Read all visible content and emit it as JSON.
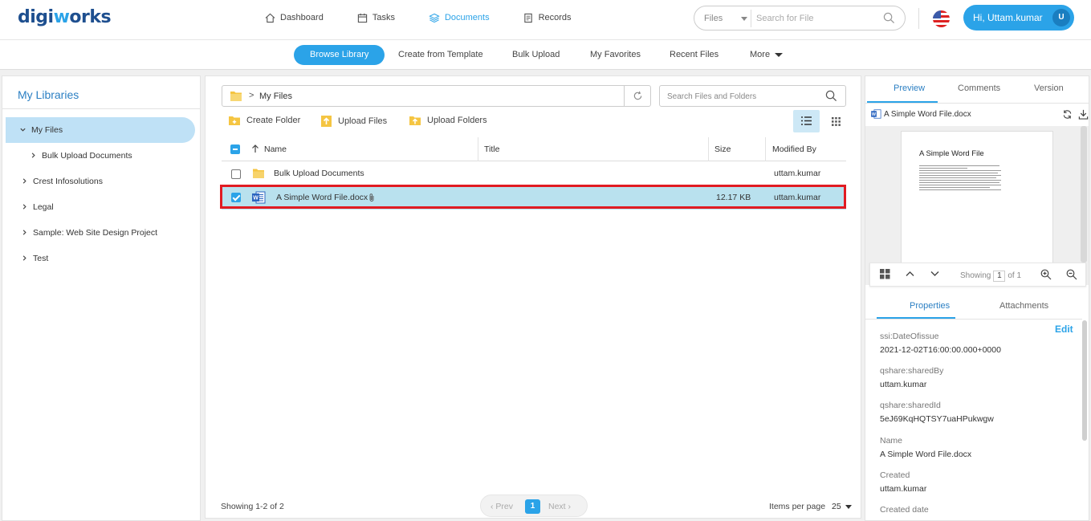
{
  "header": {
    "logo_pre": "digi",
    "logo_o": "w",
    "logo_post": "orks",
    "nav": [
      {
        "label": "Dashboard",
        "icon": "home-icon"
      },
      {
        "label": "Tasks",
        "icon": "calendar-icon"
      },
      {
        "label": "Documents",
        "icon": "layers-icon",
        "active": true
      },
      {
        "label": "Records",
        "icon": "records-icon"
      }
    ],
    "search": {
      "scope": "Files",
      "placeholder": "Search for File"
    },
    "user": {
      "greeting": "Hi,  Uttam.kumar",
      "initial": "U"
    }
  },
  "subnav": {
    "tabs": [
      "Browse Library",
      "Create from Template",
      "Bulk Upload",
      "My Favorites",
      "Recent Files",
      "More"
    ]
  },
  "libraries": {
    "title": "My Libraries",
    "items": [
      {
        "label": "My Files",
        "expanded": true
      },
      {
        "label": "Bulk Upload Documents"
      },
      {
        "label": "Crest Infosolutions"
      },
      {
        "label": "Legal"
      },
      {
        "label": "Sample: Web Site Design Project"
      },
      {
        "label": "Test"
      }
    ]
  },
  "browser": {
    "breadcrumb": "My Files",
    "search_placeholder": "Search Files and Folders",
    "actions": [
      "Create Folder",
      "Upload Files",
      "Upload Folders"
    ],
    "columns": [
      "Name",
      "Title",
      "Size",
      "Modified By"
    ],
    "rows": [
      {
        "name": "Bulk Upload Documents",
        "title": "",
        "size": "",
        "modified_by": "uttam.kumar",
        "type": "folder",
        "selected": false
      },
      {
        "name": "A Simple Word File.docx",
        "title": "",
        "size": "12.17 KB",
        "modified_by": "uttam.kumar",
        "type": "word",
        "selected": true
      }
    ],
    "showing": "Showing 1-2 of 2",
    "pager": {
      "prev": "Prev",
      "page": "1",
      "next": "Next"
    },
    "items_per_page_label": "Items per page",
    "items_per_page": "25"
  },
  "details": {
    "tabs": [
      "Preview",
      "Comments",
      "Version"
    ],
    "file_name": "A Simple Word File.docx",
    "preview": {
      "heading": "A Simple Word File",
      "showing_label": "Showing",
      "page": "1",
      "of_label": "of 1"
    },
    "prop_tabs": [
      "Properties",
      "Attachments"
    ],
    "edit_label": "Edit",
    "properties": [
      {
        "key": "ssi:DateOfissue",
        "value": "2021-12-02T16:00:00.000+0000"
      },
      {
        "key": "qshare:sharedBy",
        "value": "uttam.kumar"
      },
      {
        "key": "qshare:sharedId",
        "value": "5eJ69KqHQTSY7uaHPukwgw"
      },
      {
        "key": "Name",
        "value": "A Simple Word File.docx"
      },
      {
        "key": "Created",
        "value": "uttam.kumar"
      },
      {
        "key": "Created date",
        "value": ""
      }
    ]
  },
  "colors": {
    "accent": "#2ba3e8",
    "selected_row": "#b9e1ee",
    "highlight": "#e11b22"
  }
}
